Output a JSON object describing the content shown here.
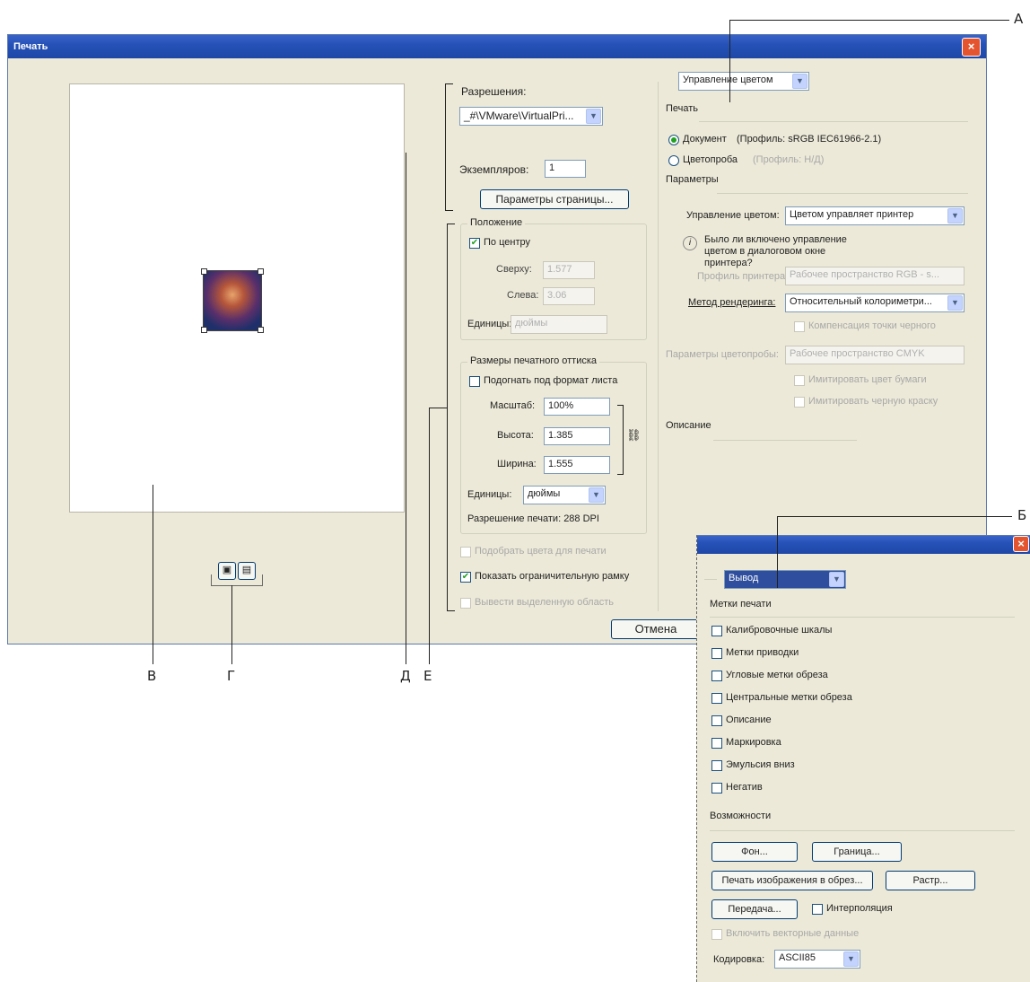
{
  "callouts": {
    "a": "А",
    "b": "Б",
    "v": "В",
    "g": "Г",
    "d": "Д",
    "e": "Е"
  },
  "print_dialog": {
    "title": "Печать",
    "printer_label": "Разрешения:",
    "printer_value": "_#\\VMware\\VirtualPri...",
    "copies_label": "Экземпляров:",
    "copies_value": "1",
    "page_setup_button": "Параметры страницы...",
    "position": {
      "legend": "Положение",
      "center_label": "По центру",
      "center_checked": true,
      "top_label": "Сверху:",
      "top_value": "1.577",
      "left_label": "Слева:",
      "left_value": "3.06",
      "units_label": "Единицы:",
      "units_value": "дюймы"
    },
    "scaled": {
      "legend": "Размеры печатного оттиска",
      "fit_label": "Подогнать под формат листа",
      "fit_checked": false,
      "scale_label": "Масштаб:",
      "scale_value": "100%",
      "height_label": "Высота:",
      "height_value": "1.385",
      "width_label": "Ширина:",
      "width_value": "1.555",
      "units_label": "Единицы:",
      "units_value": "дюймы",
      "resolution_text": "Разрешение печати: 288 DPI"
    },
    "match_colors_label": "Подобрать цвета для печати",
    "show_bbox_label": "Показать ограничительную рамку",
    "show_bbox_checked": true,
    "print_selected_label": "Вывести выделенную область",
    "cancel_button": "Отмена",
    "color_panel": {
      "mode_select": "Управление цветом",
      "print_section": "Печать",
      "document_label": "Документ",
      "document_profile": "(Профиль: sRGB IEC61966-2.1)",
      "proof_label": "Цветопроба",
      "proof_profile": "(Профиль: Н/Д)",
      "document_selected": true,
      "options_section": "Параметры",
      "color_handling_label": "Управление цветом:",
      "color_handling_value": "Цветом управляет принтер",
      "info_text": "Было ли включено управление цветом в диалоговом окне принтера?",
      "printer_profile_label": "Профиль принтера:",
      "printer_profile_value": "Рабочее пространство RGB - s...",
      "rendering_label": "Метод рендеринга:",
      "rendering_value": "Относительный колориметри...",
      "black_point_label": "Компенсация точки черного",
      "proof_setup_label": "Параметры цветопробы:",
      "proof_setup_value": "Рабочее пространство CMYK",
      "simulate_paper_label": "Имитировать цвет бумаги",
      "simulate_black_label": "Имитировать черную краску",
      "description_label": "Описание"
    }
  },
  "output_dialog": {
    "mode_select": "Вывод",
    "marks_section": "Метки печати",
    "marks": [
      "Калибровочные шкалы",
      "Метки приводки",
      "Угловые метки обреза",
      "Центральные метки обреза",
      "Описание",
      "Маркировка",
      "Эмульсия вниз",
      "Негатив"
    ],
    "functions_section": "Возможности",
    "background_button": "Фон...",
    "border_button": "Граница...",
    "bleed_button": "Печать изображения в обрез...",
    "screen_button": "Растр...",
    "transfer_button": "Передача...",
    "interpolation_label": "Интерполяция",
    "vector_data_label": "Включить векторные данные",
    "encoding_label": "Кодировка:",
    "encoding_value": "ASCII85"
  }
}
